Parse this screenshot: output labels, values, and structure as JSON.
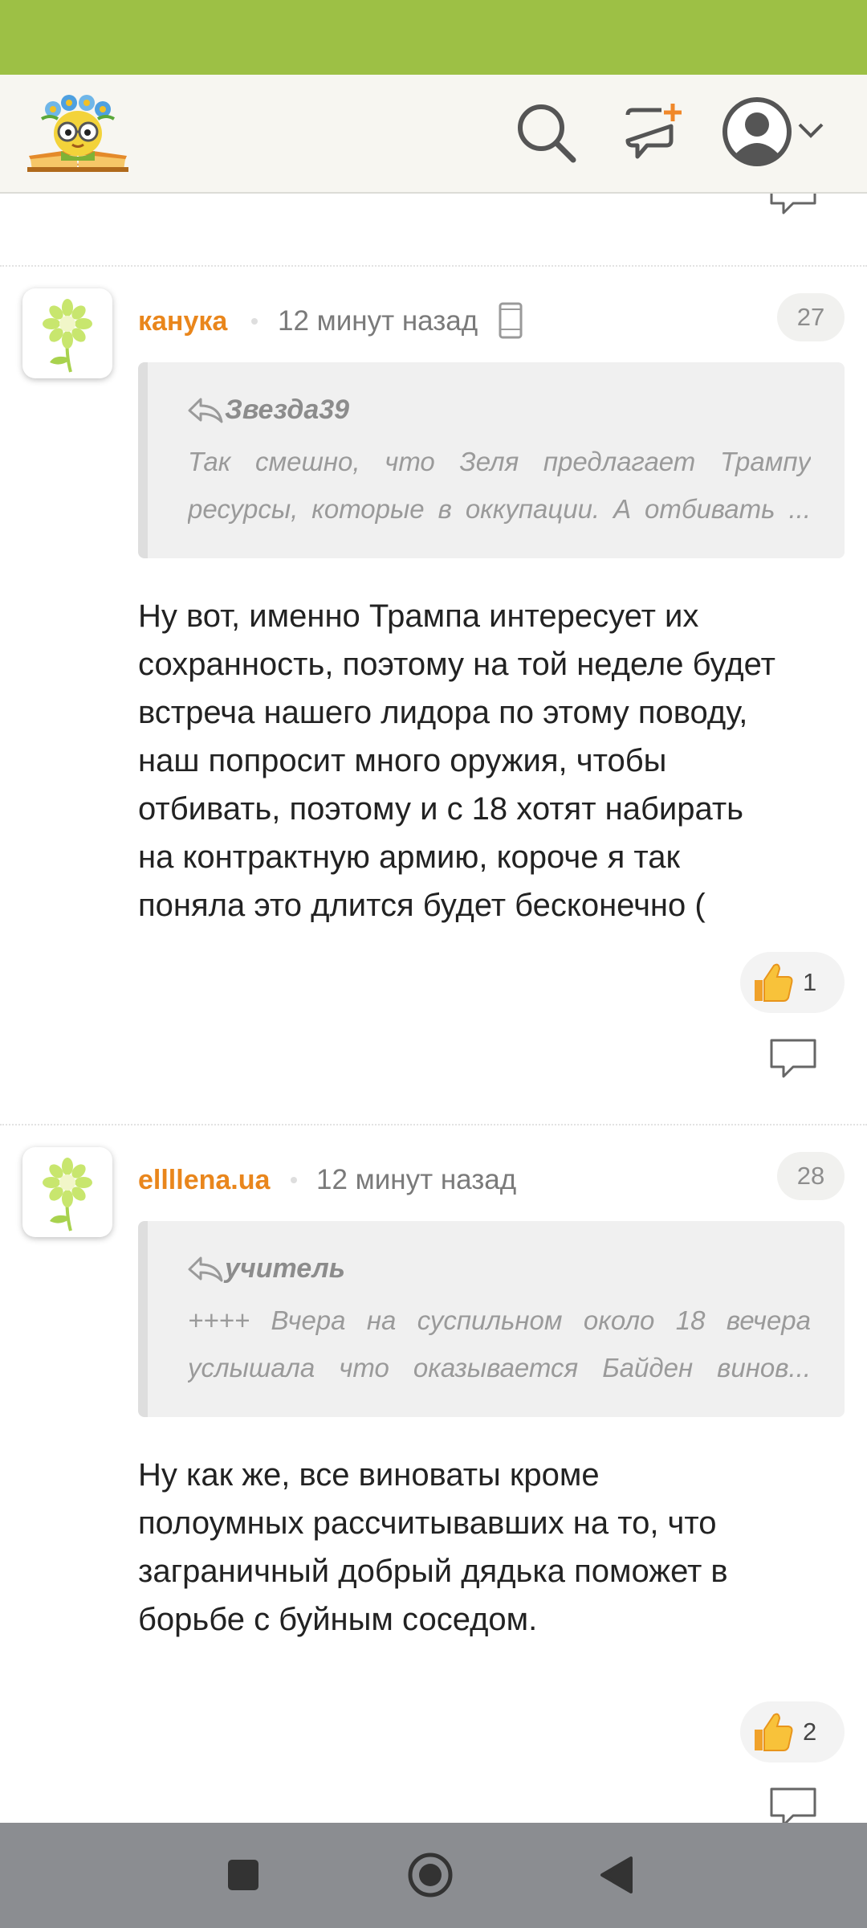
{
  "icons": {
    "search": "search-icon",
    "new_post": "new-post-icon",
    "profile": "profile-icon",
    "chevron": "chevron-down-icon",
    "reply": "reply-icon",
    "quote": "quote-arrow-icon",
    "mobile": "mobile-device-icon",
    "like": "thumbs-up-icon",
    "nav_recents": "recents-square-icon",
    "nav_home": "home-circle-icon",
    "nav_back": "back-triangle-icon"
  },
  "colors": {
    "status_bar": "#9dc045",
    "author": "#e9861c",
    "text": "#222222"
  },
  "comments": [
    {
      "author": "канука",
      "time": "12 минут назад",
      "number": "27",
      "quote": {
        "author": "Звезда39",
        "line1": "Так смешно, что Зеля предлагает Трампу",
        "line2": "ресурсы, которые в оккупации. А отбивать ..."
      },
      "lines": [
        "Ну вот, именно Трампа интересует их",
        "сохранность, поэтому на той неделе будет",
        "встреча нашего лидора по этому поводу,",
        "наш попросит много оружия, чтобы",
        "отбивать, поэтому и с 18 хотят набирать",
        "на контрактную армию, короче я так",
        "поняла это длится будет бесконечно ("
      ],
      "likes": "1"
    },
    {
      "author": "ellllena.ua",
      "time": "12 минут назад",
      "number": "28",
      "quote": {
        "author": "учитель",
        "line1": "++++ Вчера на суспильном около 18 вечера",
        "line2": "услышала что оказывается Байден винов..."
      },
      "lines": [
        "Ну как же, все виноваты кроме",
        "полоумных рассчитывавших на то, что",
        "заграничный добрый дядька поможет в",
        "борьбе с буйным соседом."
      ],
      "likes": "2"
    }
  ]
}
